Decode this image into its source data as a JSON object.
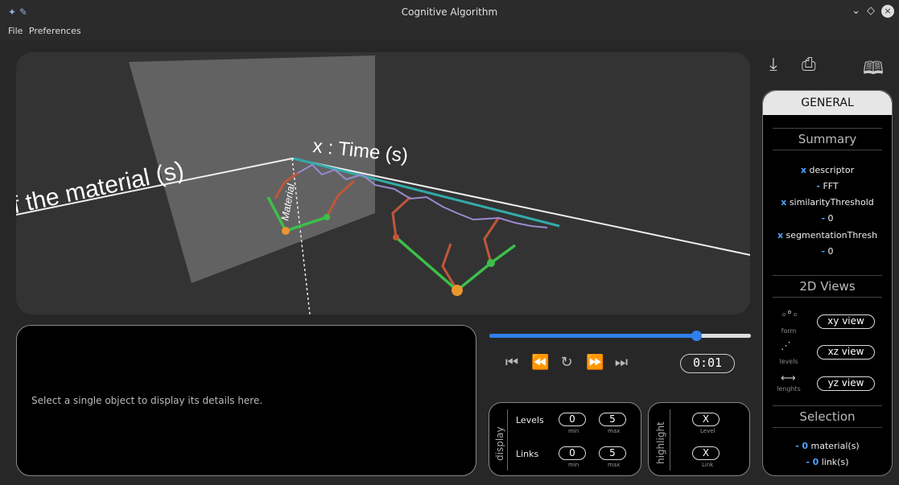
{
  "window": {
    "title": "Cognitive Algorithm",
    "left_icons": "✦ ✎",
    "controls": [
      "⌄",
      "◇"
    ],
    "close_label": "×"
  },
  "menu": {
    "items": [
      "File",
      "Preferences"
    ]
  },
  "viewport": {
    "x_axis_label": "x : Time (s)",
    "y_axis_label": "Material",
    "z_axis_label": "f the material (s)"
  },
  "details": {
    "placeholder": "Select a single object to display its details here."
  },
  "playback": {
    "progress": 0.79,
    "controls": [
      "⏮",
      "⏪",
      "↻",
      "⏩",
      "⏭"
    ],
    "time": "0:01"
  },
  "display_panel": {
    "title": "display",
    "levels_label": "Levels",
    "links_label": "Links",
    "levels_min": "0",
    "levels_max": "5",
    "links_min": "0",
    "links_max": "5",
    "min_label": "min",
    "max_label": "max"
  },
  "highlight_panel": {
    "title": "highlight",
    "level_value": "X",
    "level_label": "Level",
    "link_value": "X",
    "link_label": "Link"
  },
  "toolbar": {
    "download_icon": "⤓",
    "print_icon": "⎙",
    "book_icon": "🕮"
  },
  "sidebar": {
    "tab": "GENERAL",
    "summary_title": "Summary",
    "summary": [
      {
        "prefix": "x",
        "text": "descriptor"
      },
      {
        "prefix": "-",
        "text": "FFT"
      },
      {
        "prefix": "x",
        "text": "similarityThreshold"
      },
      {
        "prefix": "-",
        "text": "0"
      },
      {
        "prefix": "x",
        "text": "segmentationThresh"
      },
      {
        "prefix": "-",
        "text": "0"
      }
    ],
    "views_title": "2D Views",
    "views": [
      {
        "icon": "◦°◦",
        "sub": "form",
        "button": "xy view"
      },
      {
        "icon": "⋰",
        "sub": "levels",
        "button": "xz view"
      },
      {
        "icon": "⟷",
        "sub": "lenghts",
        "button": "yz view"
      }
    ],
    "selection_title": "Selection",
    "selection": [
      {
        "prefix": "-",
        "count": "0",
        "text": "material(s)"
      },
      {
        "prefix": "-",
        "count": "0",
        "text": "link(s)"
      }
    ]
  }
}
